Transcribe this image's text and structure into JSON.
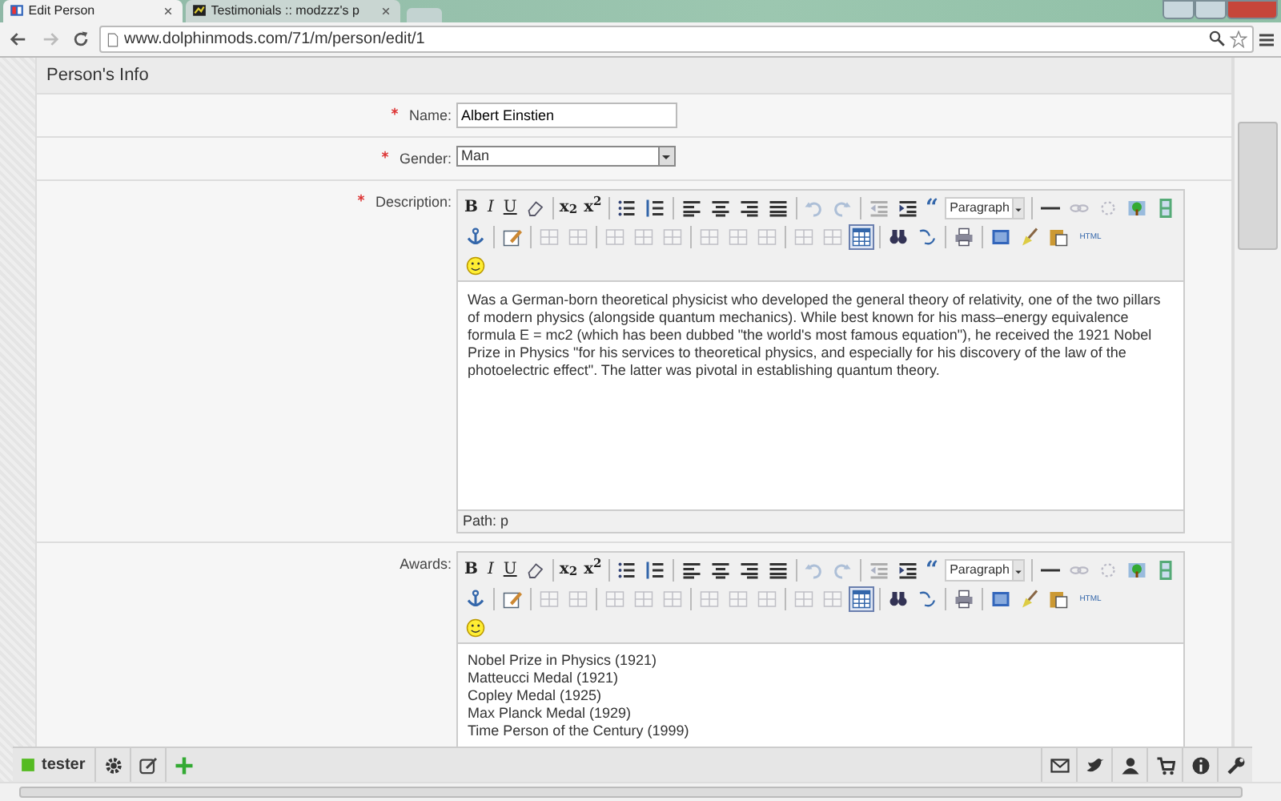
{
  "browser": {
    "tabs": [
      {
        "title": "Edit Person",
        "selected": true
      },
      {
        "title": "Testimonials :: modzzz's p",
        "selected": false
      }
    ],
    "url": "www.dolphinmods.com/71/m/person/edit/1"
  },
  "panel": {
    "title": "Person's Info"
  },
  "fields": [
    {
      "kind": "text",
      "label": "Name:",
      "required": true,
      "value": "Albert Einstien"
    },
    {
      "kind": "select",
      "label": "Gender:",
      "required": true,
      "value": "Man"
    },
    {
      "kind": "editor",
      "label": "Description:",
      "required": true,
      "toolbar": [
        [
          {
            "kind": "bold",
            "label": "B",
            "disabled": false,
            "active": false
          },
          {
            "kind": "italic",
            "label": "I",
            "disabled": false,
            "active": false
          },
          {
            "kind": "underline",
            "label": "U",
            "disabled": false,
            "active": false
          },
          {
            "kind": "eraser",
            "disabled": false,
            "active": false
          },
          {
            "kind": "separator"
          },
          {
            "kind": "subscript",
            "label": "x$_{2}$",
            "disabled": false,
            "active": false
          },
          {
            "kind": "superscript",
            "label": "x$^{2}$",
            "disabled": false,
            "active": false
          },
          {
            "kind": "separator"
          },
          {
            "kind": "bullets",
            "disabled": false,
            "active": false
          },
          {
            "kind": "numbers",
            "disabled": false,
            "active": false
          },
          {
            "kind": "separator"
          },
          {
            "kind": "align-left",
            "disabled": false,
            "active": false
          },
          {
            "kind": "align-center",
            "disabled": false,
            "active": false
          },
          {
            "kind": "align-right",
            "disabled": false,
            "active": false
          },
          {
            "kind": "justify",
            "disabled": false,
            "active": false
          },
          {
            "kind": "separator"
          },
          {
            "kind": "undo",
            "disabled": true,
            "active": false
          },
          {
            "kind": "redo",
            "disabled": true,
            "active": false
          },
          {
            "kind": "separator"
          },
          {
            "kind": "outdent",
            "disabled": true,
            "active": false
          },
          {
            "kind": "indent",
            "disabled": false,
            "active": false
          },
          {
            "kind": "quote",
            "label": "“",
            "disabled": false,
            "active": false
          },
          {
            "kind": "format",
            "value": "Paragraph"
          },
          {
            "kind": "separator"
          },
          {
            "kind": "rule",
            "disabled": false,
            "active": false
          },
          {
            "kind": "link",
            "disabled": true,
            "active": false
          },
          {
            "kind": "unlink",
            "disabled": true,
            "active": false
          },
          {
            "kind": "image",
            "disabled": false,
            "active": false
          },
          {
            "kind": "media",
            "disabled": false,
            "active": false
          }
        ],
        [
          {
            "kind": "anchor",
            "disabled": false,
            "active": false
          },
          {
            "kind": "separator"
          },
          {
            "kind": "code",
            "disabled": false,
            "active": false
          },
          {
            "kind": "separator"
          },
          {
            "kind": "row-before",
            "disabled": true,
            "active": false
          },
          {
            "kind": "row-after",
            "disabled": true,
            "active": false
          },
          {
            "kind": "separator"
          },
          {
            "kind": "col-before",
            "disabled": true,
            "active": false
          },
          {
            "kind": "col-after",
            "disabled": true,
            "active": false
          },
          {
            "kind": "col-delete",
            "disabled": true,
            "active": false
          },
          {
            "kind": "separator"
          },
          {
            "kind": "split",
            "disabled": true,
            "active": false
          },
          {
            "kind": "merge",
            "disabled": true,
            "active": false
          },
          {
            "kind": "cell",
            "disabled": true,
            "active": false
          },
          {
            "kind": "separator"
          },
          {
            "kind": "row-props",
            "disabled": true,
            "active": false
          },
          {
            "kind": "cell-props",
            "disabled": true,
            "active": false
          },
          {
            "kind": "table",
            "disabled": false,
            "active": true
          },
          {
            "kind": "separator"
          },
          {
            "kind": "find",
            "disabled": false,
            "active": false
          },
          {
            "kind": "replace",
            "disabled": false,
            "active": false
          },
          {
            "kind": "separator"
          },
          {
            "kind": "print",
            "disabled": false,
            "active": false
          },
          {
            "kind": "separator"
          },
          {
            "kind": "fullscreen",
            "disabled": false,
            "active": false
          },
          {
            "kind": "cleanup",
            "disabled": false,
            "active": false
          },
          {
            "kind": "paste",
            "disabled": false,
            "active": false
          },
          {
            "kind": "html",
            "label": "HTML",
            "disabled": false,
            "active": false
          }
        ],
        [
          {
            "kind": "smiley",
            "disabled": false,
            "active": false
          }
        ]
      ],
      "content": [
        "Was a German-born theoretical physicist who developed the general theory of relativity, one of the two pillars of modern physics (alongside quantum mechanics). While best known for his mass–energy equivalence formula E = mc2 (which has been dubbed \"the world's most famous equation\"), he received the 1921 Nobel Prize in Physics \"for his services to theoretical physics, and especially for his discovery of the law of the photoelectric effect\". The latter was pivotal in establishing quantum theory."
      ],
      "path": "Path: p"
    },
    {
      "kind": "editor",
      "label": "Awards:",
      "required": false,
      "toolbar": [
        [
          {
            "kind": "bold",
            "label": "B",
            "disabled": false,
            "active": false
          },
          {
            "kind": "italic",
            "label": "I",
            "disabled": false,
            "active": false
          },
          {
            "kind": "underline",
            "label": "U",
            "disabled": false,
            "active": false
          },
          {
            "kind": "eraser",
            "disabled": false,
            "active": false
          },
          {
            "kind": "separator"
          },
          {
            "kind": "subscript",
            "label": "x$_{2}$",
            "disabled": false,
            "active": false
          },
          {
            "kind": "superscript",
            "label": "x$^{2}$",
            "disabled": false,
            "active": false
          },
          {
            "kind": "separator"
          },
          {
            "kind": "bullets",
            "disabled": false,
            "active": false
          },
          {
            "kind": "numbers",
            "disabled": false,
            "active": false
          },
          {
            "kind": "separator"
          },
          {
            "kind": "align-left",
            "disabled": false,
            "active": false
          },
          {
            "kind": "align-center",
            "disabled": false,
            "active": false
          },
          {
            "kind": "align-right",
            "disabled": false,
            "active": false
          },
          {
            "kind": "justify",
            "disabled": false,
            "active": false
          },
          {
            "kind": "separator"
          },
          {
            "kind": "undo",
            "disabled": true,
            "active": false
          },
          {
            "kind": "redo",
            "disabled": true,
            "active": false
          },
          {
            "kind": "separator"
          },
          {
            "kind": "outdent",
            "disabled": true,
            "active": false
          },
          {
            "kind": "indent",
            "disabled": false,
            "active": false
          },
          {
            "kind": "quote",
            "label": "“",
            "disabled": false,
            "active": false
          },
          {
            "kind": "format",
            "value": "Paragraph"
          },
          {
            "kind": "separator"
          },
          {
            "kind": "rule",
            "disabled": false,
            "active": false
          },
          {
            "kind": "link",
            "disabled": true,
            "active": false
          },
          {
            "kind": "unlink",
            "disabled": true,
            "active": false
          },
          {
            "kind": "image",
            "disabled": false,
            "active": false
          },
          {
            "kind": "media",
            "disabled": false,
            "active": false
          }
        ],
        [
          {
            "kind": "anchor",
            "disabled": false,
            "active": false
          },
          {
            "kind": "separator"
          },
          {
            "kind": "code",
            "disabled": false,
            "active": false
          },
          {
            "kind": "separator"
          },
          {
            "kind": "row-before",
            "disabled": true,
            "active": false
          },
          {
            "kind": "row-after",
            "disabled": true,
            "active": false
          },
          {
            "kind": "separator"
          },
          {
            "kind": "col-before",
            "disabled": true,
            "active": false
          },
          {
            "kind": "col-after",
            "disabled": true,
            "active": false
          },
          {
            "kind": "col-delete",
            "disabled": true,
            "active": false
          },
          {
            "kind": "separator"
          },
          {
            "kind": "split",
            "disabled": true,
            "active": false
          },
          {
            "kind": "merge",
            "disabled": true,
            "active": false
          },
          {
            "kind": "cell",
            "disabled": true,
            "active": false
          },
          {
            "kind": "separator"
          },
          {
            "kind": "row-props",
            "disabled": true,
            "active": false
          },
          {
            "kind": "cell-props",
            "disabled": true,
            "active": false
          },
          {
            "kind": "table",
            "disabled": false,
            "active": true
          },
          {
            "kind": "separator"
          },
          {
            "kind": "find",
            "disabled": false,
            "active": false
          },
          {
            "kind": "replace",
            "disabled": false,
            "active": false
          },
          {
            "kind": "separator"
          },
          {
            "kind": "print",
            "disabled": false,
            "active": false
          },
          {
            "kind": "separator"
          },
          {
            "kind": "fullscreen",
            "disabled": false,
            "active": false
          },
          {
            "kind": "cleanup",
            "disabled": false,
            "active": false
          },
          {
            "kind": "paste",
            "disabled": false,
            "active": false
          },
          {
            "kind": "html",
            "label": "HTML",
            "disabled": false,
            "active": false
          }
        ],
        [
          {
            "kind": "smiley",
            "disabled": false,
            "active": false
          }
        ]
      ],
      "content": [
        "Nobel Prize in Physics (1921)",
        "Matteucci Medal (1921)",
        "Copley Medal (1925)",
        "Max Planck Medal (1929)",
        "Time Person of the Century (1999)"
      ]
    }
  ],
  "bottom_bar": {
    "user": "tester"
  }
}
